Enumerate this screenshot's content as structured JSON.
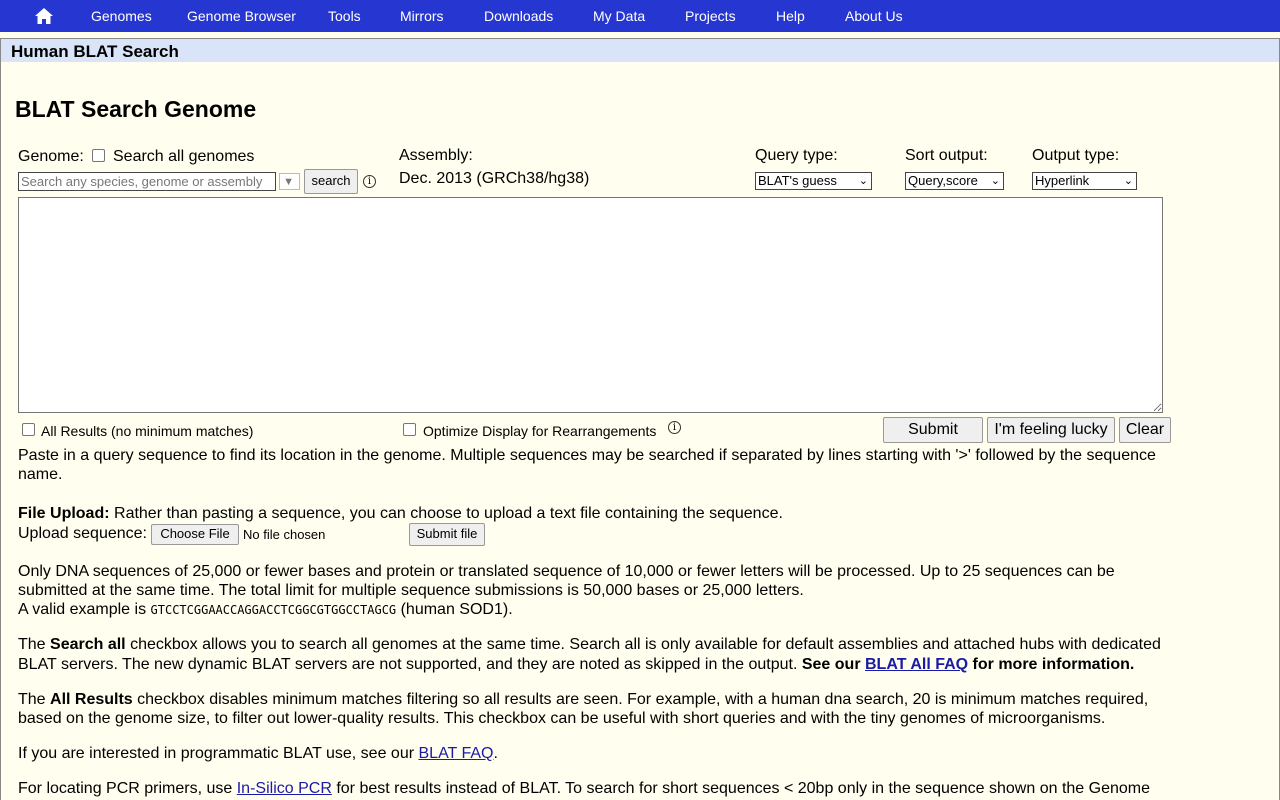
{
  "nav": {
    "items": [
      "Genomes",
      "Genome Browser",
      "Tools",
      "Mirrors",
      "Downloads",
      "My Data",
      "Projects",
      "Help",
      "About Us"
    ]
  },
  "title_bar": "Human BLAT Search",
  "page_heading": "BLAT Search Genome",
  "form": {
    "genome_label": "Genome:",
    "search_all_label": "Search all genomes",
    "search_all_checked": false,
    "genome_search_placeholder": "Search any species, genome or assembly",
    "search_button": "search",
    "assembly_label": "Assembly:",
    "assembly_value": "Dec. 2013 (GRCh38/hg38)",
    "query_type_label": "Query type:",
    "query_type_value": "BLAT's guess",
    "sort_output_label": "Sort output:",
    "sort_output_value": "Query,score",
    "output_type_label": "Output type:",
    "output_type_value": "Hyperlink",
    "sequence_value": "",
    "all_results_label": "All Results (no minimum matches)",
    "all_results_checked": false,
    "optimize_label": "Optimize Display for Rearrangements",
    "optimize_checked": false,
    "submit_button": "Submit",
    "lucky_button": "I'm feeling lucky",
    "clear_button": "Clear"
  },
  "help_text": {
    "paste": "Paste in a query sequence to find its location in the genome. Multiple sequences may be searched if separated by lines starting with '>' followed by the sequence name.",
    "file_upload_bold": "File Upload:",
    "file_upload_rest": " Rather than pasting a sequence, you can choose to upload a text file containing the sequence.",
    "upload_label": "Upload sequence:",
    "choose_file_button": "Choose File",
    "no_file_text": "No file chosen",
    "submit_file_button": "Submit file",
    "limits": "Only DNA sequences of 25,000 or fewer bases and protein or translated sequence of 10,000 or fewer letters will be processed. Up to 25 sequences can be submitted at the same time. The total limit for multiple sequence submissions is 50,000 bases or 25,000 letters.",
    "example_prefix": "A valid example is ",
    "example_seq": "GTCCTCGGAACCAGGACCTCGGCGTGGCCTAGCG",
    "example_suffix": " (human SOD1).",
    "search_all_p1": "The ",
    "search_all_bold": "Search all",
    "search_all_p2": " checkbox allows you to search all genomes at the same time. Search all is only available for default assemblies and attached hubs with dedicated BLAT servers. The new dynamic BLAT servers are not supported, and they are noted as skipped in the output. ",
    "search_all_bold2": "See our ",
    "search_all_link": "BLAT All FAQ",
    "search_all_bold3": " for more information.",
    "all_results_p1": "The ",
    "all_results_bold": "All Results",
    "all_results_p2": " checkbox disables minimum matches filtering so all results are seen. For example, with a human dna search, 20 is minimum matches required, based on the genome size, to filter out lower-quality results. This checkbox can be useful with short queries and with the tiny genomes of microorganisms.",
    "programmatic_p1": "If you are interested in programmatic BLAT use, see our ",
    "programmatic_link": "BLAT FAQ",
    "programmatic_p2": ".",
    "pcr_p1": "For locating PCR primers, use ",
    "pcr_link": "In-Silico PCR",
    "pcr_p2": " for best results instead of BLAT. To search for short sequences < 20bp only in the sequence shown on the Genome"
  }
}
